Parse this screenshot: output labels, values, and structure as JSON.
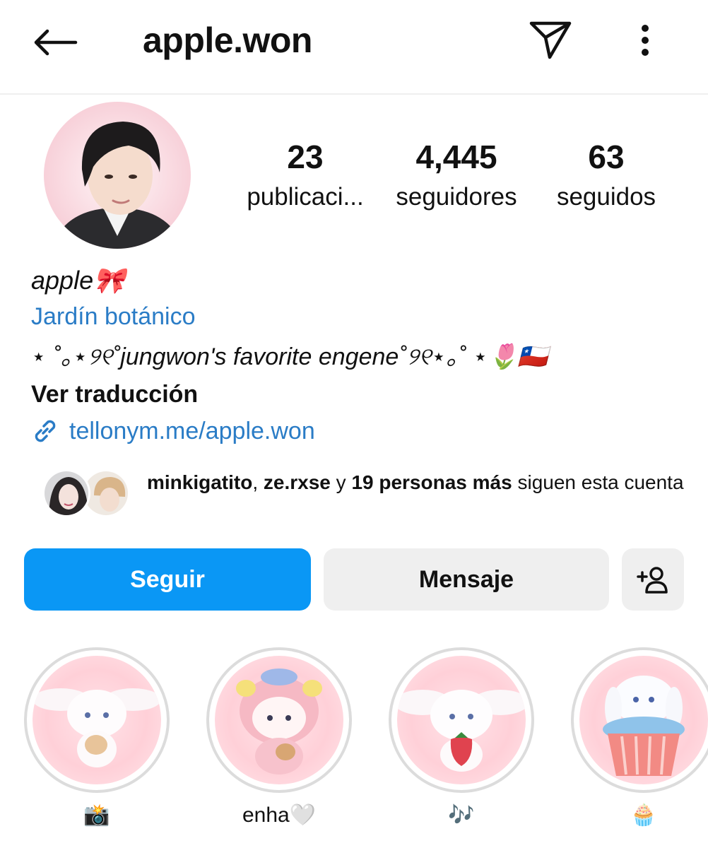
{
  "header": {
    "username": "apple.won",
    "back_icon": "arrow-left-icon",
    "send_icon": "paper-plane-icon",
    "more_icon": "more-vertical-icon"
  },
  "profile": {
    "avatar_icon": "profile-photo",
    "stats": [
      {
        "value": "23",
        "label": "publicaci..."
      },
      {
        "value": "4,445",
        "label": "seguidores"
      },
      {
        "value": "63",
        "label": "seguidos"
      }
    ],
    "name": "apple🎀",
    "category": "Jardín botánico",
    "bio": "⋆ ˚｡⋆୨୧˚jungwon's favorite engene˚୨୧⋆｡˚ ⋆🌷🇨🇱",
    "translate_label": "Ver traducción",
    "link_icon": "link-icon",
    "link": "tellonym.me/apple.won"
  },
  "followed_by": {
    "user1": "minkigatito",
    "separator": ", ",
    "user2": "ze.rxse",
    "connector": " y ",
    "others": "19 personas más",
    "suffix": " siguen esta cuenta"
  },
  "actions": {
    "follow_label": "Seguir",
    "message_label": "Mensaje",
    "add_user_icon": "add-user-icon"
  },
  "colors": {
    "accent_blue": "#0a97f5",
    "link_blue": "#2a7cc6",
    "button_gray": "#efefef"
  },
  "highlights": [
    {
      "label": "📸"
    },
    {
      "label": "enha🤍"
    },
    {
      "label": "🎶"
    },
    {
      "label": "🧁"
    }
  ]
}
